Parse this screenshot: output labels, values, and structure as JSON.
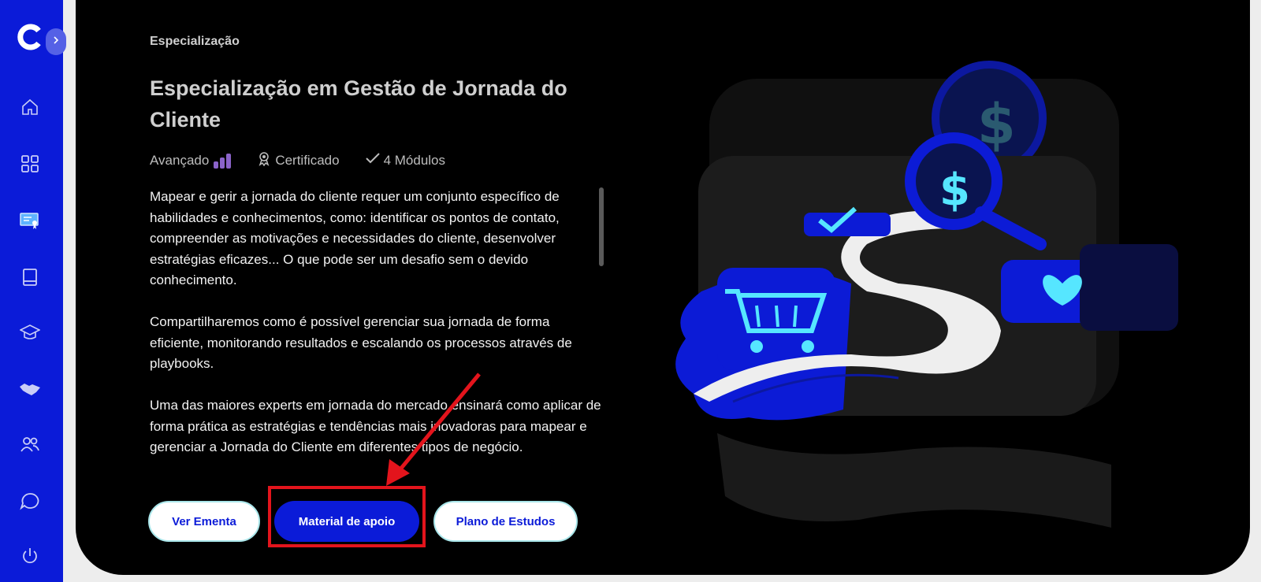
{
  "sidebar": {
    "logo": "brand-c-logo",
    "toggle_icon": "chevron-right-icon",
    "items": [
      {
        "name": "home-icon"
      },
      {
        "name": "dashboard-icon"
      },
      {
        "name": "certificate-icon"
      },
      {
        "name": "book-icon"
      },
      {
        "name": "graduation-cap-icon"
      },
      {
        "name": "handshake-icon"
      },
      {
        "name": "users-icon"
      },
      {
        "name": "chat-icon"
      },
      {
        "name": "power-icon"
      }
    ],
    "accent": "#0b1bd8"
  },
  "course": {
    "category": "Especialização",
    "title": "Especialização em Gestão de Jornada do Cliente",
    "level": "Avançado",
    "certificate": "Certificado",
    "modules": "4 Módulos",
    "description": [
      "Mapear e gerir a jornada do cliente requer um conjunto específico de habilidades e conhecimentos, como: identificar os pontos de contato, compreender as motivações e necessidades do cliente, desenvolver estratégias eficazes... O que pode ser um desafio sem o devido conhecimento.",
      "Compartilharemos como é possível gerenciar sua jornada de forma eficiente, monitorando resultados e escalando os processos através de playbooks.",
      "Uma das maiores experts em jornada do mercado ensinará como aplicar de forma prática as estratégias e tendências mais inovadoras para mapear e gerenciar a Jornada do Cliente em diferentes tipos de negócio."
    ]
  },
  "actions": {
    "syllabus": "Ver Ementa",
    "support_material": "Material de apoio",
    "study_plan": "Plano de Estudos"
  },
  "colors": {
    "primary": "#0b1bd8",
    "annotation": "#e3141c",
    "level_bars": "#8a63c9"
  }
}
